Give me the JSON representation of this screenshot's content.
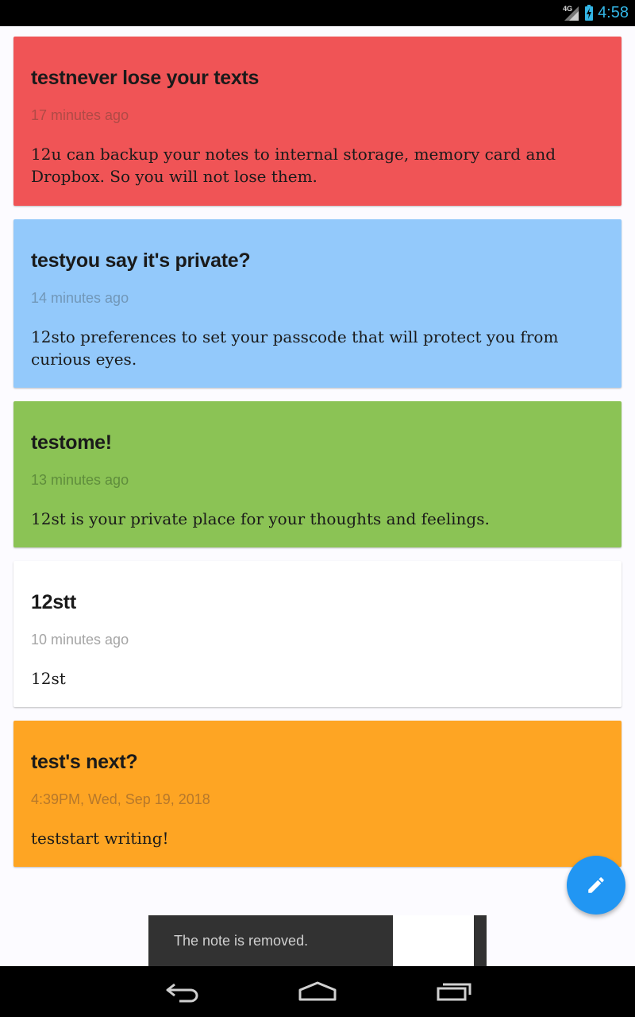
{
  "status_bar": {
    "network_label": "4G",
    "time": "4:58",
    "accent_color": "#33b5e5"
  },
  "notes": [
    {
      "title": "testnever lose your texts",
      "time": "17 minutes ago",
      "body": "12u can backup your notes to internal storage, memory card and Dropbox. So you will not lose them.",
      "color": "#f05456",
      "time_color": "#b04a46"
    },
    {
      "title": "testyou say it's private?",
      "time": "14 minutes ago",
      "body": "12sto preferences to set your passcode that will protect you from curious eyes.",
      "color": "#93c9fb",
      "time_color": "#7197b8"
    },
    {
      "title": "testome!",
      "time": "13 minutes ago",
      "body": "12st is your private place for your thoughts and feelings.",
      "color": "#8bc355",
      "time_color": "#5f8d3c"
    },
    {
      "title": "12stt",
      "time": "10 minutes ago",
      "body": "12st",
      "color": "#ffffff",
      "time_color": "#a5a5a5"
    },
    {
      "title": "test's next?",
      "time": "4:39PM, Wed, Sep 19, 2018",
      "body": "teststart writing!",
      "color": "#fea523",
      "time_color": "#b6782b"
    }
  ],
  "fab": {
    "icon": "pencil-icon",
    "color": "#2196f3"
  },
  "snackbar": {
    "message": "The note is removed."
  },
  "nav_bar": {
    "back_icon": "back-icon",
    "home_icon": "home-icon",
    "recents_icon": "recents-icon"
  }
}
